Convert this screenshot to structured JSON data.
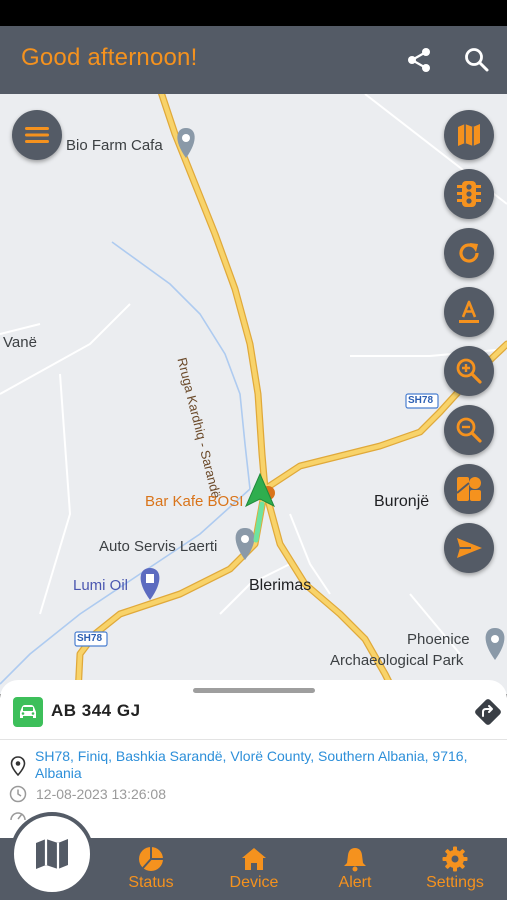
{
  "header": {
    "title": "Good afternoon!",
    "share_icon": "share-icon",
    "search_icon": "search-icon"
  },
  "map": {
    "labels": {
      "bio_farm": "Bio Farm Cafa",
      "road_name": "Rruga Kardhiq - Sarandë",
      "vane": "Vanë",
      "bar_kafe": "Bar Kafe BOSI",
      "buronje": "Buronjë",
      "auto_servis": "Auto Servis Laerti",
      "lumi_oil": "Lumi Oil",
      "blerimas": "Blerimas",
      "sh78_left": "SH78",
      "sh78_right": "SH78",
      "phoenice": "Phoenice",
      "archaeological": "Archaeological Park"
    },
    "controls": [
      "map-type-icon",
      "traffic-icon",
      "refresh-icon",
      "label-toggle-icon",
      "zoom-in-icon",
      "zoom-out-icon",
      "layers-icon",
      "send-location-icon"
    ],
    "colors": {
      "road": "#f7c54a",
      "accent": "#f5921e",
      "vehicle": "#3dbf5a"
    }
  },
  "vehicle": {
    "plate": "AB 344 GJ",
    "address": "SH78, Finiq, Bashkia Sarandë, Vlorë County, Southern Albania, 9716, Albania",
    "timestamp": "12-08-2023 13:26:08"
  },
  "tabs": {
    "map_icon": "map-icon",
    "status": "Status",
    "device": "Device",
    "alert": "Alert",
    "settings": "Settings"
  }
}
